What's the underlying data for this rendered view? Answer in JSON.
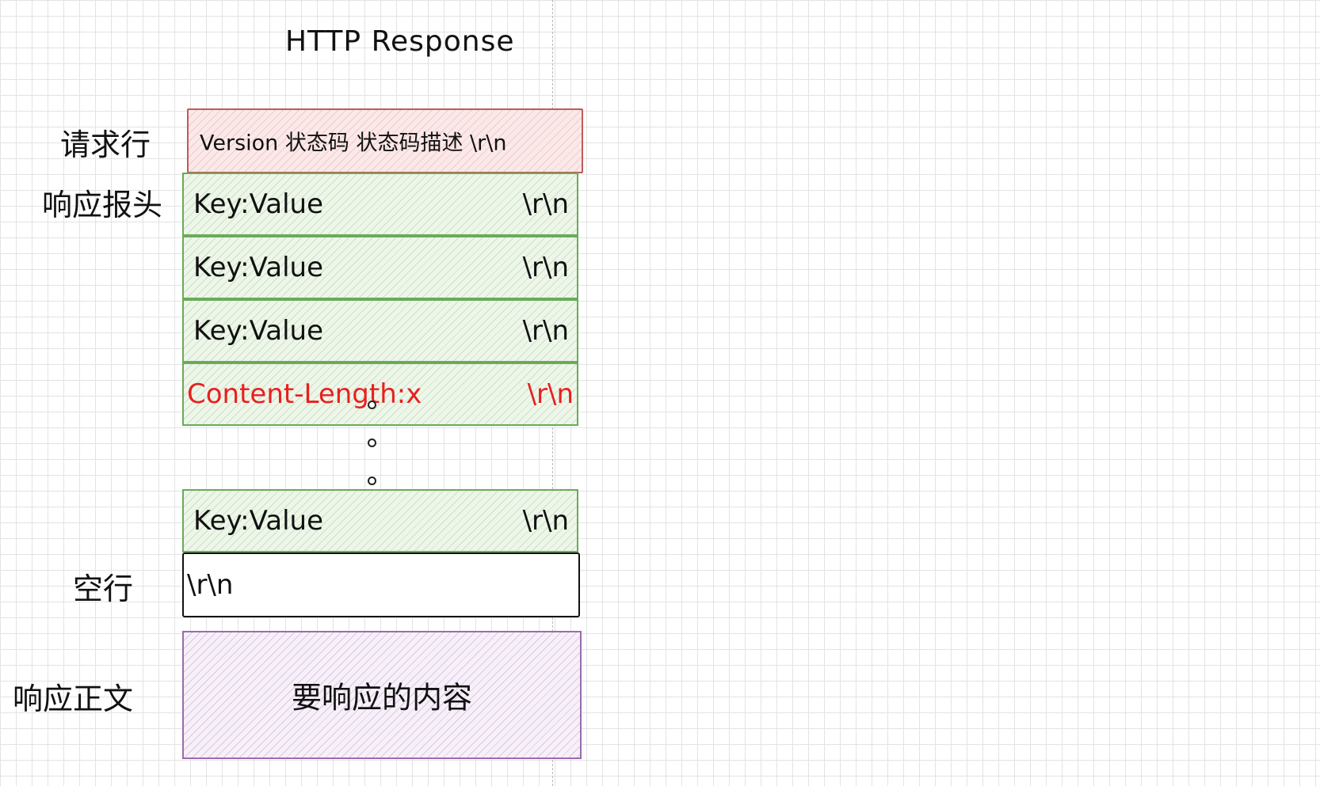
{
  "diagram": {
    "title": "HTTP Response",
    "labels": {
      "request_line": "请求行",
      "headers": "响应报头",
      "blank_line": "空行",
      "body": "响应正文"
    },
    "status_line": "Version 状态码 状态码描述 \\r\\n",
    "header_rows": [
      {
        "left": "Key:Value",
        "right": "\\r\\n"
      },
      {
        "left": "Key:Value",
        "right": "\\r\\n"
      },
      {
        "left": "Key:Value",
        "right": "\\r\\n"
      },
      {
        "left": "Content-Length:x",
        "right": "\\r\\n"
      },
      {
        "left": "Key:Value",
        "right": "\\r\\n"
      }
    ],
    "blank_line_text": "\\r\\n",
    "body_text": "要响应的内容"
  },
  "colors": {
    "request_line_border": "#c15a5a",
    "header_border": "#6aab5a",
    "body_border": "#9b6cad",
    "highlight_text": "#e8201f"
  }
}
